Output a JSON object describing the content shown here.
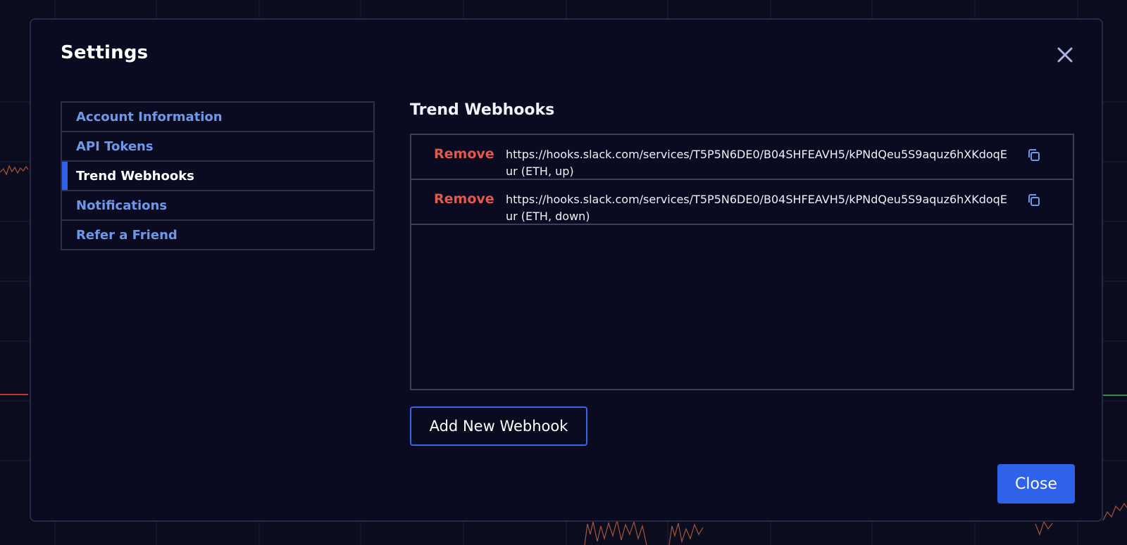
{
  "dialog": {
    "title": "Settings",
    "close_label": "Close"
  },
  "sidebar": {
    "items": [
      {
        "label": "Account Information",
        "active": false
      },
      {
        "label": "API Tokens",
        "active": false
      },
      {
        "label": "Trend Webhooks",
        "active": true
      },
      {
        "label": "Notifications",
        "active": false
      },
      {
        "label": "Refer a Friend",
        "active": false
      }
    ]
  },
  "main": {
    "section_title": "Trend Webhooks",
    "webhooks": [
      {
        "remove_label": "Remove",
        "url": "https://hooks.slack.com/services/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 (ETH, up)"
      },
      {
        "remove_label": "Remove",
        "url": "https://hooks.slack.com/services/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 (ETH, down)"
      }
    ],
    "add_button_label": "Add New Webhook"
  },
  "colors": {
    "accent": "#2f62ea",
    "link": "#6f98e8",
    "danger": "#e35a4c",
    "background": "#0a0b20",
    "redaction": "#f2f23a"
  }
}
